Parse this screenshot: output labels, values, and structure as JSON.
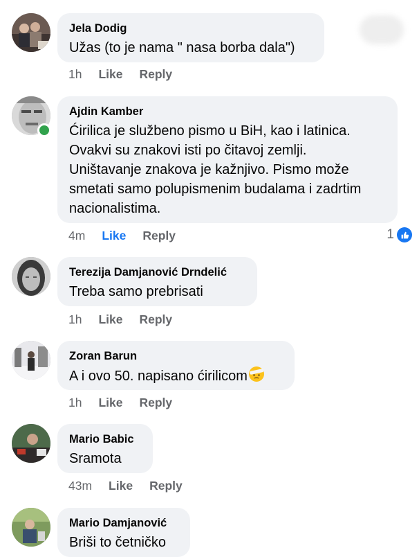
{
  "comments": [
    {
      "author": "Jela Dodig",
      "text": "Užas (to je nama \" nasa borba dala\")",
      "time": "1h",
      "like": "Like",
      "reply": "Reply"
    },
    {
      "author": "Ajdin Kamber",
      "text_lines": [
        "Ćirilica je službeno pismo u BiH, kao i latinica.",
        "Ovakvi su znakovi isti po čitavoj zemlji.",
        "Uništavanje znakova je kažnjivo. Pismo može",
        "smetati samo polupismenim budalama i zadrtim",
        "nacionalistima."
      ],
      "time": "4m",
      "like": "Like",
      "reply": "Reply",
      "reaction_count": "1"
    },
    {
      "author": "Terezija Damjanović Drndelić",
      "text": "Treba samo prebrisati",
      "time": "1h",
      "like": "Like",
      "reply": "Reply"
    },
    {
      "author": "Zoran Barun",
      "text": "A i ovo 50. napisano ćirilicom",
      "time": "1h",
      "like": "Like",
      "reply": "Reply"
    },
    {
      "author": "Mario Babic",
      "text": "Sramota",
      "time": "43m",
      "like": "Like",
      "reply": "Reply"
    },
    {
      "author": "Mario Damjanović",
      "text": "Briši to četničko"
    }
  ],
  "colors": {
    "bubble": "#f0f2f5",
    "meta": "#65676b",
    "like_active": "#1877f2",
    "online": "#31a24c"
  },
  "icons": {
    "reaction": "like-thumb-icon",
    "emoji": "face-with-head-bandage-emoji"
  }
}
